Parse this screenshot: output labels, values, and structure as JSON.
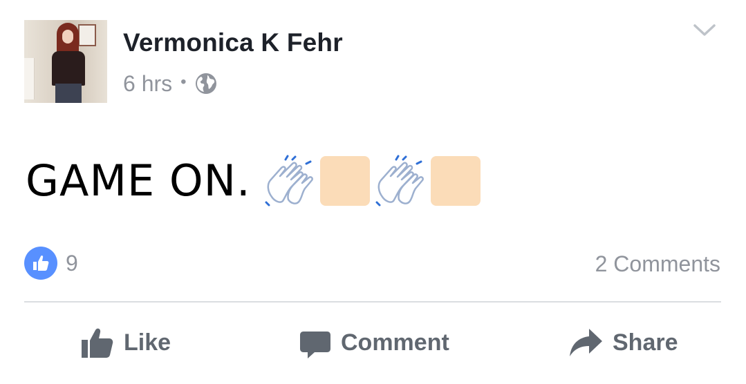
{
  "post": {
    "author": "Vermonica K Fehr",
    "time": "6 hrs",
    "separator": "•",
    "privacy_icon": "globe-icon",
    "menu_icon": "chevron-down-icon",
    "text": "GAME ON.",
    "emoji": [
      "clapping-hands-icon",
      "skin-tone-swatch",
      "clapping-hands-icon",
      "skin-tone-swatch"
    ]
  },
  "stats": {
    "like_count": "9",
    "comments": "2 Comments",
    "like_badge_color": "#5890ff"
  },
  "actions": {
    "like": "Like",
    "comment": "Comment",
    "share": "Share",
    "color": "#606770"
  },
  "colors": {
    "text": "#1d2129",
    "meta": "#90949c",
    "divider": "#dadde1",
    "skin_tone": "#fbdcb8"
  }
}
